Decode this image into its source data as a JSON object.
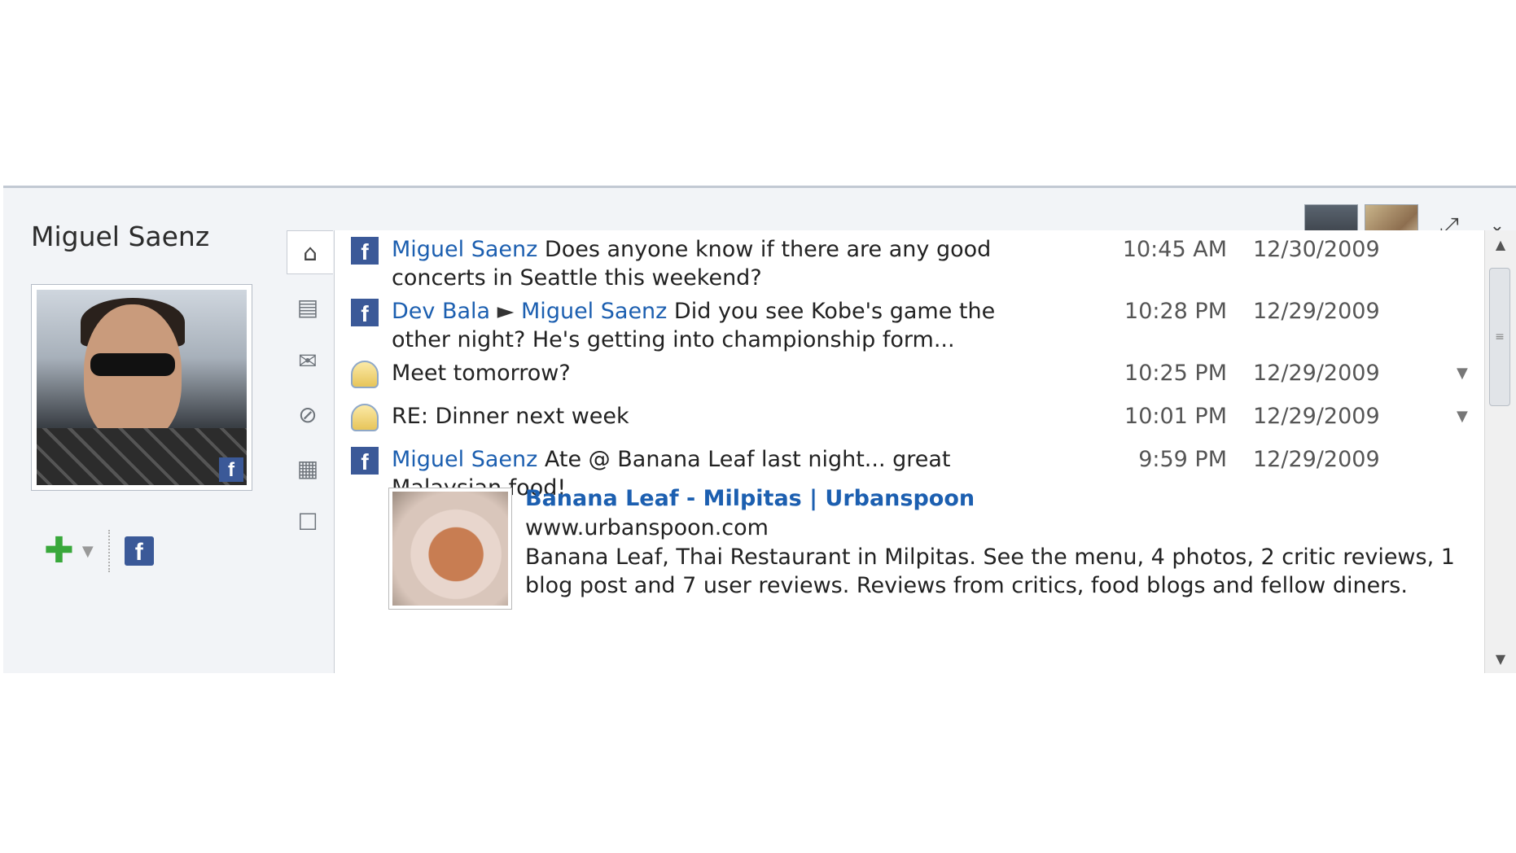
{
  "header": {
    "title": "Miguel Saenz",
    "expand_icon": "expand-icon",
    "menu_icon": "chevron-down-icon"
  },
  "actions": {
    "add_icon": "plus-icon",
    "facebook_label": "f"
  },
  "profile": {
    "badge": "f"
  },
  "rail": [
    {
      "icon": "home-icon",
      "glyph": "⌂"
    },
    {
      "icon": "activity-icon",
      "glyph": "▤"
    },
    {
      "icon": "mail-icon",
      "glyph": "✉"
    },
    {
      "icon": "attachment-icon",
      "glyph": "⊘"
    },
    {
      "icon": "calendar-icon",
      "glyph": "▦"
    },
    {
      "icon": "status-icon",
      "glyph": "☐"
    }
  ],
  "feed": [
    {
      "type": "facebook",
      "name": "Miguel Saenz",
      "text": " Does anyone know if there are any good concerts in Seattle this weekend?",
      "time": "10:45 AM",
      "date": "12/30/2009"
    },
    {
      "type": "facebook",
      "name": "Dev Bala",
      "arrow": " ► ",
      "name2": "Miguel Saenz",
      "text": " Did you see Kobe's game the other night? He's getting into championship form...",
      "time": "10:28 PM",
      "date": "12/29/2009"
    },
    {
      "type": "mail",
      "text": "Meet tomorrow?",
      "time": "10:25 PM",
      "date": "12/29/2009",
      "dropdown": "▼"
    },
    {
      "type": "mail",
      "text": "RE: Dinner next week",
      "time": "10:01 PM",
      "date": "12/29/2009",
      "dropdown": "▼"
    },
    {
      "type": "facebook",
      "name": "Miguel Saenz",
      "text": " Ate @ Banana Leaf last night... great Malaysian food!",
      "time": "9:59 PM",
      "date": "12/29/2009"
    }
  ],
  "link_preview": {
    "title": "Banana Leaf - Milpitas | Urbanspoon",
    "url": "www.urbanspoon.com",
    "description": "Banana Leaf, Thai Restaurant in Milpitas. See the menu, 4 photos, 2 critic reviews, 1 blog post and 7 user reviews. Reviews from critics, food blogs and fellow diners."
  },
  "scrollbar": {
    "up": "▲",
    "down": "▼",
    "grip": "≡"
  }
}
